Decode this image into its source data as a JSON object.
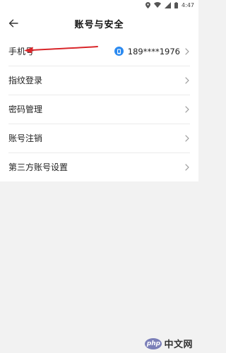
{
  "status_bar": {
    "time": "4:47"
  },
  "header": {
    "title": "账号与安全"
  },
  "settings": [
    {
      "label": "手机号",
      "value": "189****1976"
    },
    {
      "label": "指纹登录"
    },
    {
      "label": "密码管理"
    },
    {
      "label": "账号注销"
    },
    {
      "label": "第三方账号设置"
    }
  ],
  "watermark": {
    "badge": "php",
    "text": "中文网"
  },
  "colors": {
    "accent_blue": "#2b8af0",
    "annotation_red": "#d9262a",
    "background": "#f2f2f2"
  }
}
